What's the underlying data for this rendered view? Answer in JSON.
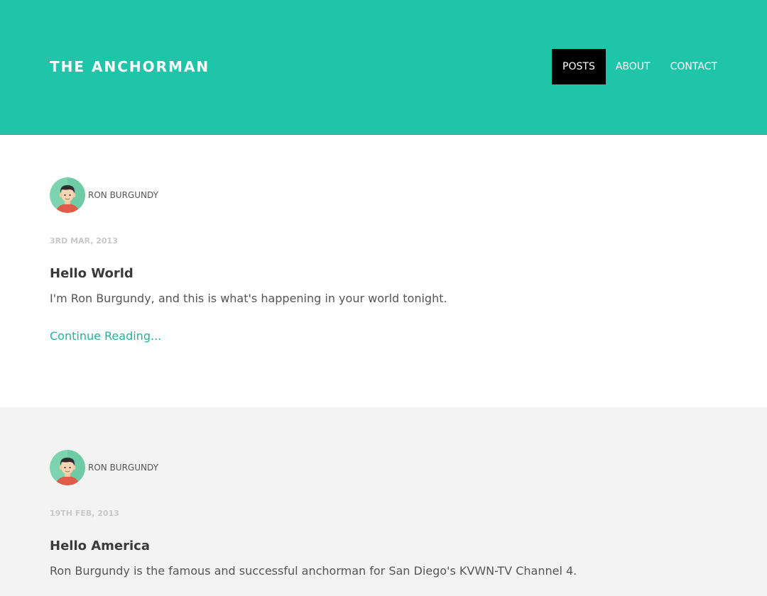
{
  "site": {
    "title": "THE ANCHORMAN"
  },
  "nav": {
    "items": [
      {
        "label": "POSTS",
        "active": true
      },
      {
        "label": "ABOUT",
        "active": false
      },
      {
        "label": "CONTACT",
        "active": false
      }
    ]
  },
  "posts": [
    {
      "author": "RON BURGUNDY",
      "date": "3RD MAR, 2013",
      "title": "Hello World",
      "excerpt": "I'm Ron Burgundy, and this is what's happening in your world tonight.",
      "read_more": "Continue Reading..."
    },
    {
      "author": "RON BURGUNDY",
      "date": "19TH FEB, 2013",
      "title": "Hello America",
      "excerpt": "Ron Burgundy is the famous and successful anchorman for San Diego's KVWN-TV Channel 4."
    }
  ],
  "colors": {
    "header_bg": "#1fc5a8",
    "nav_active_bg": "#000000",
    "link": "#1fb59a",
    "alt_section_bg": "#f3f3f3"
  }
}
